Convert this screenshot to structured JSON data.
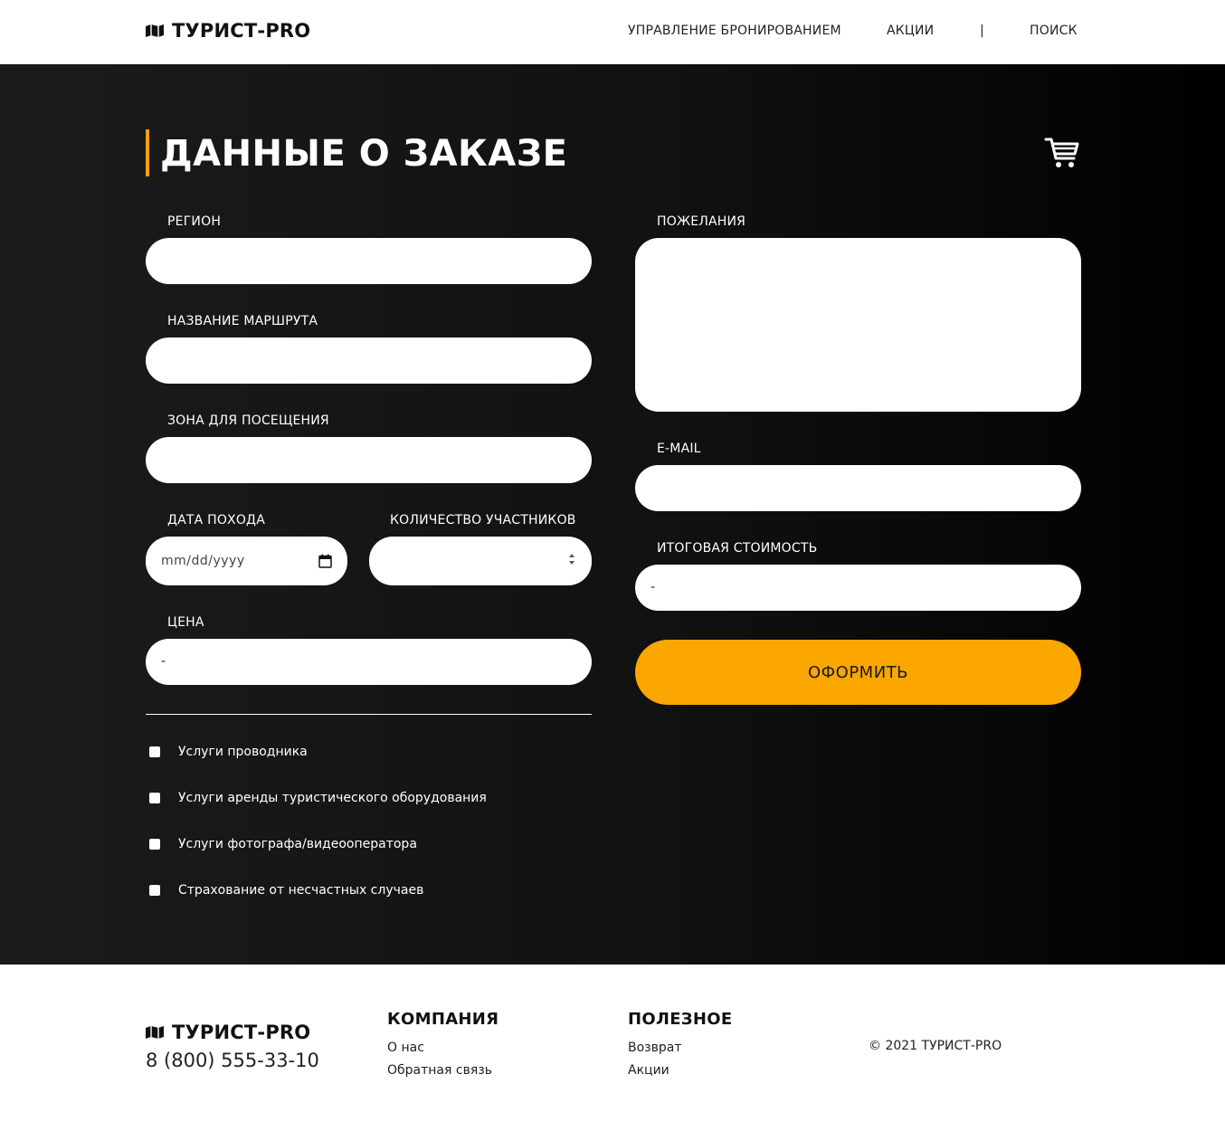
{
  "brand": {
    "name": "ТУРИСТ-PRO",
    "icon": "map-icon",
    "accent": "#f7a200",
    "button_color": "#fca600"
  },
  "nav": {
    "booking": "УПРАВЛЕНИЕ БРОНИРОВАНИЕМ",
    "promo": "АКЦИИ",
    "separator": "|",
    "search": "ПОИСК"
  },
  "main": {
    "title": "ДАННЫЕ О ЗАКАЗЕ",
    "cart_icon": "cart-icon",
    "fields": {
      "region": {
        "label": "РЕГИОН",
        "value": ""
      },
      "route": {
        "label": "НАЗВАНИЕ МАРШРУТА",
        "value": ""
      },
      "zone": {
        "label": "ЗОНА ДЛЯ ПОСЕЩЕНИЯ",
        "value": ""
      },
      "date": {
        "label": "ДАТА ПОХОДА",
        "placeholder": "mm/dd/yyyy"
      },
      "participants": {
        "label": "КОЛИЧЕСТВО УЧАСТНИКОВ",
        "value": ""
      },
      "price": {
        "label": "ЦЕНА",
        "value": "-"
      },
      "wishes": {
        "label": "ПОЖЕЛАНИЯ",
        "value": ""
      },
      "email": {
        "label": "E-MAIL",
        "value": ""
      },
      "total": {
        "label": "ИТОГОВАЯ СТОИМОСТЬ",
        "value": "-"
      }
    },
    "services": [
      {
        "label": "Услуги проводника",
        "checked": false
      },
      {
        "label": "Услуги аренды туристического оборудования",
        "checked": false
      },
      {
        "label": "Услуги фотографа/видеооператора",
        "checked": false
      },
      {
        "label": "Страхование от несчастных случаев",
        "checked": false
      }
    ],
    "submit_label": "ОФОРМИТЬ"
  },
  "footer": {
    "brand": "ТУРИСТ-PRO",
    "phone": "8 (800) 555-33-10",
    "company": {
      "heading": "КОМПАНИЯ",
      "links": [
        "О нас",
        "Обратная связь"
      ]
    },
    "useful": {
      "heading": "ПОЛЕЗНОЕ",
      "links": [
        "Возврат",
        "Акции"
      ]
    },
    "copyright": "© 2021 ТУРИСТ-PRO"
  }
}
